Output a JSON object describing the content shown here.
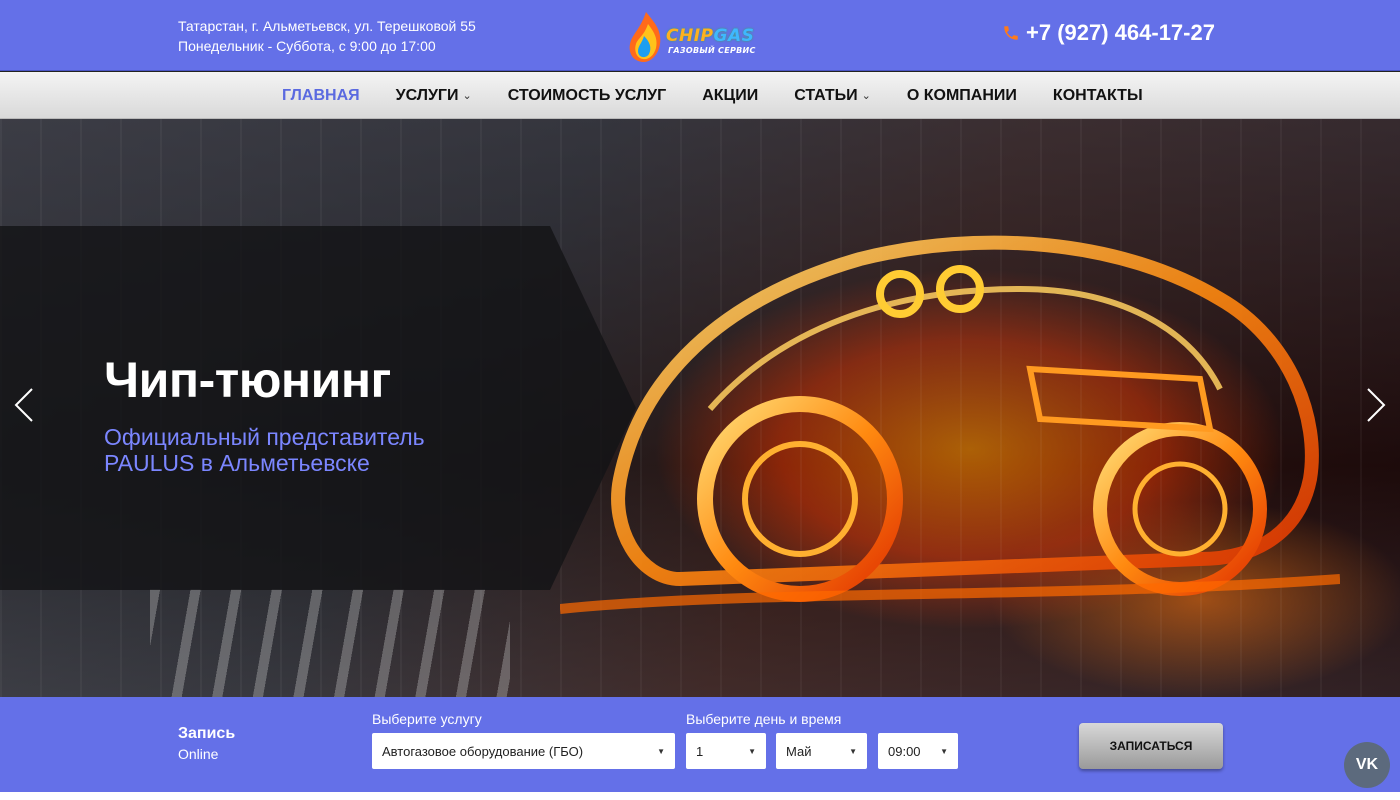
{
  "header": {
    "address": "Татарстан, г. Альметьевск, ул. Терешковой 55",
    "hours": "Понедельник - Суббота, с 9:00 до 17:00",
    "logo_main_a": "CHIP",
    "logo_main_b": "GAS",
    "logo_sub": "ГАЗОВЫЙ СЕРВИС",
    "phone": "+7 (927) 464-17-27",
    "phone_icon": "phone-icon",
    "phone_icon_color": "#ff7a1a"
  },
  "nav": {
    "items": [
      {
        "label": "Главная",
        "active": true
      },
      {
        "label": "Услуги",
        "dropdown": true
      },
      {
        "label": "Стоимость услуг"
      },
      {
        "label": "Акции"
      },
      {
        "label": "Статьи",
        "dropdown": true
      },
      {
        "label": "О компании"
      },
      {
        "label": "Контакты"
      }
    ],
    "active_color": "#5b6ae0"
  },
  "hero": {
    "title": "Чип-тюнинг",
    "subtitle_line1": "Официальный представитель",
    "subtitle_line2": "PAULUS в Альметьевске",
    "prev_icon": "chevron-left-icon",
    "next_icon": "chevron-right-icon"
  },
  "booking": {
    "title": "Запись",
    "subtitle": "Online",
    "service_label": "Выберите услугу",
    "service_value": "Автогазовое оборудование (ГБО)",
    "datetime_label": "Выберите день и время",
    "day_value": "1",
    "month_value": "Май",
    "time_value": "09:00",
    "submit_label": "ЗАПИСАТЬСЯ"
  },
  "social": {
    "vk_label": "VK"
  },
  "colors": {
    "brand": "#6470e8",
    "accent_text": "#7b86ff"
  }
}
